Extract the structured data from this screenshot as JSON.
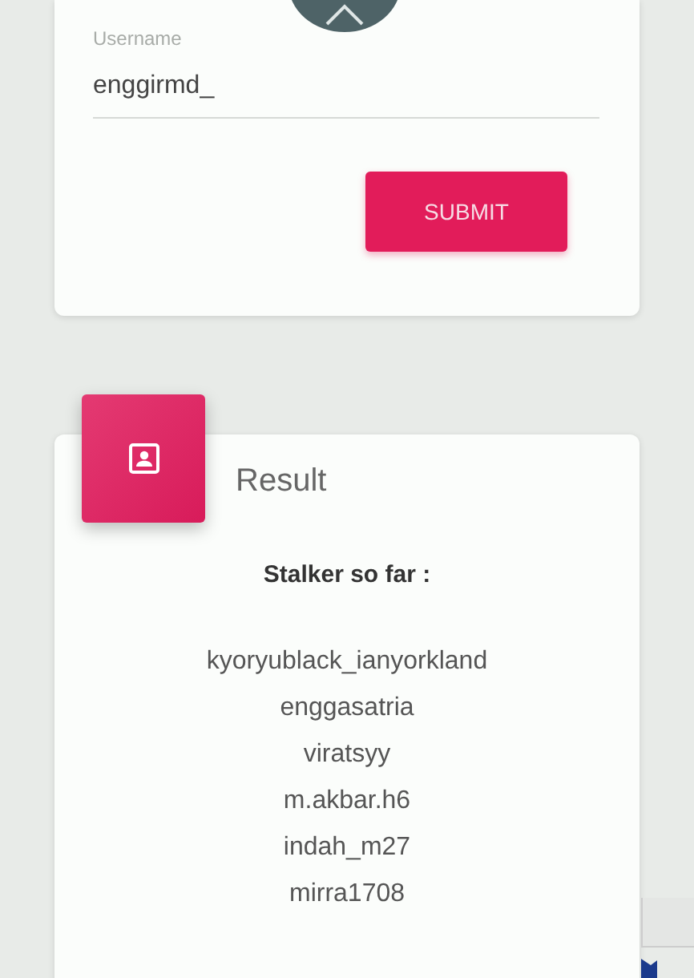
{
  "form": {
    "field": {
      "label": "Username",
      "value": "enggirmd_"
    },
    "button": "SUBMIT"
  },
  "result": {
    "title": "Result",
    "subtitle": "Stalker so far :",
    "names": [
      "kyoryublack_ianyorkland",
      "enggasatria",
      "viratsyy",
      "m.akbar.h6",
      "indah_m27",
      "mirra1708"
    ]
  }
}
